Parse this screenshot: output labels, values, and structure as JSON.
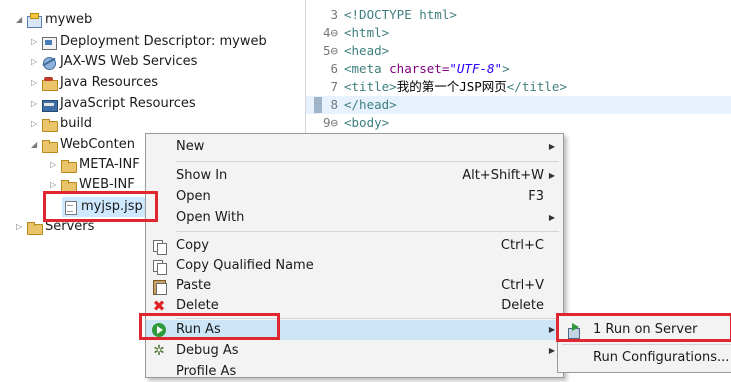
{
  "explorer": {
    "items": [
      {
        "label": "myweb"
      },
      {
        "label": "Deployment Descriptor: myweb"
      },
      {
        "label": "JAX-WS Web Services"
      },
      {
        "label": "Java Resources"
      },
      {
        "label": "JavaScript Resources"
      },
      {
        "label": "build"
      },
      {
        "label": "WebConten"
      },
      {
        "label": "META-INF"
      },
      {
        "label": "WEB-INF"
      },
      {
        "label": "myjsp.jsp"
      },
      {
        "label": "Servers"
      }
    ]
  },
  "editor": {
    "lines": [
      {
        "num": "3",
        "content": "<!DOCTYPE html>"
      },
      {
        "num": "4⊖",
        "tag": "<html>"
      },
      {
        "num": "5⊖",
        "tag": "<head>"
      },
      {
        "num": "6",
        "tag_open": "<meta ",
        "attr": "charset=",
        "str": "\"UTF-8\"",
        "tag_close": ">"
      },
      {
        "num": "7",
        "tag_open": "<title>",
        "text": "我的第一个JSP网页",
        "tag_close": "</title>"
      },
      {
        "num": "8",
        "tag": "</head>"
      },
      {
        "num": "9⊖",
        "tag": "<body>"
      }
    ]
  },
  "context_menu": {
    "new": "New",
    "show_in": "Show In",
    "show_in_shortcut": "Alt+Shift+W",
    "open": "Open",
    "open_shortcut": "F3",
    "open_with": "Open With",
    "copy": "Copy",
    "copy_shortcut": "Ctrl+C",
    "copy_qualified": "Copy Qualified Name",
    "paste": "Paste",
    "paste_shortcut": "Ctrl+V",
    "delete": "Delete",
    "delete_shortcut": "Delete",
    "run_as": "Run As",
    "debug_as": "Debug As",
    "profile_as": "Profile As"
  },
  "submenu": {
    "run_on_server": "1 Run on Server",
    "run_configurations": "Run Configurations..."
  },
  "colors": {
    "highlight_box": "#e0262f",
    "selection": "#cde6f7"
  },
  "icons": {
    "project": "web-project-icon",
    "folder": "folder-icon",
    "file": "jsp-file-icon",
    "run": "run-icon",
    "debug": "debug-icon"
  }
}
